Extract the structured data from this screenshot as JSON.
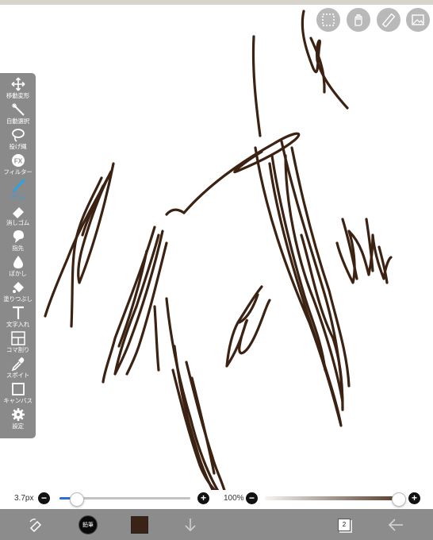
{
  "top_buttons": [
    {
      "name": "selection-icon"
    },
    {
      "name": "hand-tool-icon"
    },
    {
      "name": "ruler-icon"
    },
    {
      "name": "image-icon"
    }
  ],
  "toolbar": {
    "items": [
      {
        "label": "移動変形",
        "icon": "move-icon"
      },
      {
        "label": "自動選択",
        "icon": "magic-wand-icon"
      },
      {
        "label": "投げ縄",
        "icon": "lasso-icon"
      },
      {
        "label": "フィルター",
        "icon": "fx-filter-icon",
        "glyph": "FX"
      },
      {
        "label": "ブラシ",
        "icon": "brush-icon",
        "active": true
      },
      {
        "label": "消しゴム",
        "icon": "eraser-icon"
      },
      {
        "label": "指先",
        "icon": "finger-icon"
      },
      {
        "label": "ぼかし",
        "icon": "blur-drop-icon"
      },
      {
        "label": "塗りつぶし",
        "icon": "fill-bucket-icon"
      },
      {
        "label": "文字入れ",
        "icon": "text-icon",
        "glyph": "T"
      },
      {
        "label": "コマ割り",
        "icon": "frame-divide-icon"
      },
      {
        "label": "スポイト",
        "icon": "eyedropper-icon"
      },
      {
        "label": "キャンバス",
        "icon": "canvas-icon"
      },
      {
        "label": "設定",
        "icon": "settings-gear-icon"
      }
    ]
  },
  "brush_size": {
    "label": "3.7px",
    "minus": "−",
    "plus": "+",
    "value_fraction": 0.13
  },
  "opacity": {
    "label": "100%",
    "minus": "−",
    "plus": "+",
    "value_fraction": 1.0
  },
  "bottom_bar": {
    "brush_preview_label": "鉛筆",
    "layer_count": "2",
    "color": "#3a2214"
  },
  "colors": {
    "stroke": "#3b2212",
    "toolbar": "#8a8a8a",
    "active": "#2aa3e6",
    "slider_fill": "#2c6fd1"
  }
}
